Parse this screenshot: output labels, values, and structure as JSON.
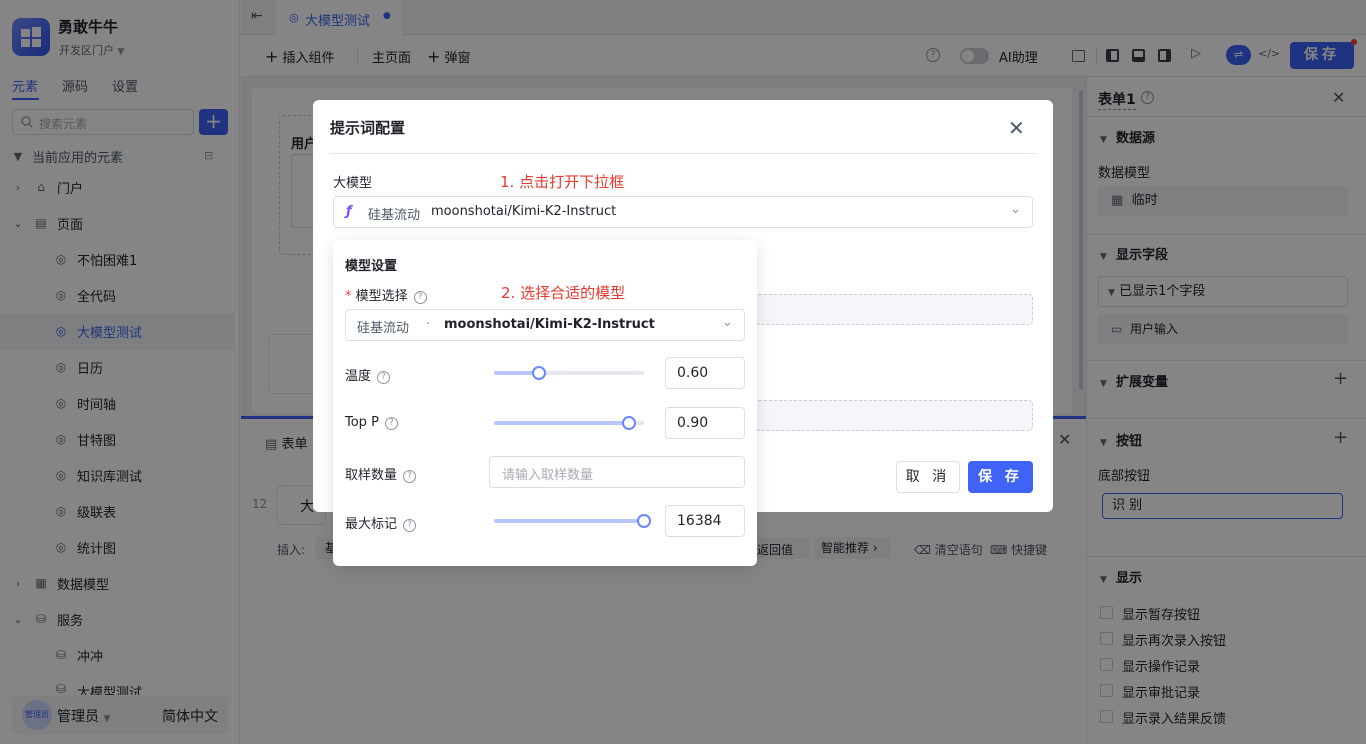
{
  "app": {
    "name": "勇敢牛牛",
    "subtitle": "开发区门户"
  },
  "sidebar": {
    "tabs": [
      "元素",
      "源码",
      "设置"
    ],
    "search_placeholder": "搜索元素",
    "add_label": "+",
    "section_title": "当前应用的元素",
    "items": [
      {
        "label": "门户",
        "icon": "home-icon"
      },
      {
        "label": "页面",
        "icon": "page-icon"
      },
      {
        "label": "不怕困难1",
        "icon": "page-link-icon"
      },
      {
        "label": "全代码",
        "icon": "page-link-icon"
      },
      {
        "label": "大模型测试",
        "icon": "page-link-icon"
      },
      {
        "label": "日历",
        "icon": "page-link-icon"
      },
      {
        "label": "时间轴",
        "icon": "page-link-icon"
      },
      {
        "label": "甘特图",
        "icon": "page-link-icon"
      },
      {
        "label": "知识库测试",
        "icon": "page-link-icon"
      },
      {
        "label": "级联表",
        "icon": "page-link-icon"
      },
      {
        "label": "统计图",
        "icon": "page-link-icon"
      },
      {
        "label": "数据模型",
        "icon": "table-icon"
      },
      {
        "label": "服务",
        "icon": "service-icon"
      },
      {
        "label": "冲冲",
        "icon": "service-item-icon"
      },
      {
        "label": "大模型测试",
        "icon": "service-item-icon"
      }
    ],
    "user": "管理员",
    "avatar_text": "管理员",
    "language": "简体中文"
  },
  "topbar": {
    "doc_tab": "大模型测试",
    "unsaved_dot": "●"
  },
  "toolbar": {
    "insert_component": "插入组件",
    "main_page": "主页面",
    "popup": "弹窗",
    "ai_assistant": "AI助理",
    "save": "保存"
  },
  "canvas": {
    "user_label": "用户",
    "form_tab": "表单",
    "row_no": "12",
    "row_text": "大",
    "insert_label": "插入:",
    "insert_first": "基",
    "return_value": "返回值",
    "smart_recommend": "智能推荐",
    "clear_statement": "清空语句",
    "shortcut": "快捷键"
  },
  "right_panel": {
    "title": "表单1",
    "data_source": "数据源",
    "data_model_label": "数据模型",
    "data_model_value": "临时",
    "display_fields": "显示字段",
    "fields_shown": "已显示1个字段",
    "field_user_input": "用户输入",
    "ext_vars": "扩展变量",
    "buttons": "按钮",
    "bottom_buttons": "底部按钮",
    "button_value": "识 别",
    "display": "显示",
    "checks": [
      "显示暂存按钮",
      "显示再次录入按钮",
      "显示操作记录",
      "显示审批记录",
      "显示录入结果反馈"
    ]
  },
  "modal": {
    "title": "提示词配置",
    "model_label": "大模型",
    "annotation1": "1. 点击打开下拉框",
    "provider": "硅基流动",
    "model_name": "moonshotai/Kimi-K2-Instruct",
    "cancel": "取 消",
    "save": "保 存"
  },
  "popover": {
    "title": "模型设置",
    "required_mark": "*",
    "model_select_label": "模型选择",
    "annotation2": "2. 选择合适的模型",
    "provider": "硅基流动",
    "separator": "·",
    "model_name": "moonshotai/Kimi-K2-Instruct",
    "temperature_label": "温度",
    "temperature": "0.60",
    "topp_label": "Top P",
    "topp": "0.90",
    "samples_label": "取样数量",
    "samples_placeholder": "请输入取样数量",
    "maxtokens_label": "最大标记",
    "maxtokens": "16384"
  },
  "sliders": {
    "temperature": 0.3,
    "topp": 0.9,
    "maxtokens": 1.0
  },
  "colors": {
    "accent": "#3e63f5",
    "annotation": "#e8392e"
  }
}
